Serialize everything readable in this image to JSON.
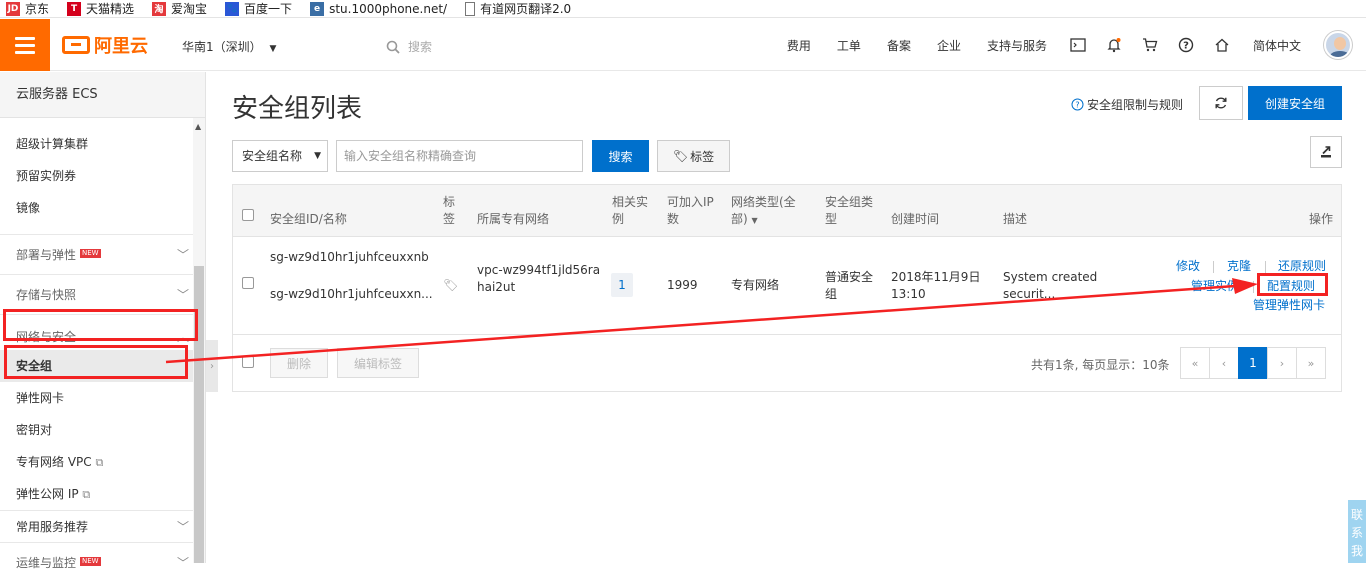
{
  "bookmarks": [
    {
      "label": "京东",
      "icon": "jd-icon",
      "color": "#e4393c",
      "glyph": "JD"
    },
    {
      "label": "天猫精选",
      "icon": "tmall-icon",
      "color": "#d4001c",
      "glyph": "T"
    },
    {
      "label": "爱淘宝",
      "icon": "taobao-icon",
      "color": "#e4393c",
      "glyph": "淘"
    },
    {
      "label": "百度一下",
      "icon": "baidu-icon",
      "color": "#2a57d6",
      "glyph": "🐾"
    },
    {
      "label": "stu.1000phone.net/",
      "icon": "globe-icon",
      "color": "#3a6ea5",
      "glyph": "e"
    },
    {
      "label": "有道网页翻译2.0",
      "icon": "page-icon",
      "color": "#ffffff",
      "glyph": ""
    }
  ],
  "topbar": {
    "brand": "阿里云",
    "region": "华南1（深圳）",
    "search_placeholder": "搜索",
    "links": [
      "费用",
      "工单",
      "备案",
      "企业",
      "支持与服务"
    ],
    "language": "简体中文"
  },
  "sidebar": {
    "title": "云服务器 ECS",
    "items_top": [
      "超级计算集群",
      "预留实例券",
      "镜像"
    ],
    "groups": [
      {
        "label": "部署与弹性",
        "badge": "NEW"
      },
      {
        "label": "存储与快照",
        "badge": ""
      },
      {
        "label": "网络与安全",
        "badge": ""
      }
    ],
    "net_items": [
      "安全组",
      "弹性网卡",
      "密钥对",
      "专有网络 VPC",
      "弹性公网 IP"
    ],
    "bottom_groups": [
      {
        "label": "常用服务推荐",
        "badge": ""
      },
      {
        "label": "运维与监控",
        "badge": "NEW"
      }
    ]
  },
  "main": {
    "title": "安全组列表",
    "limits_link": "安全组限制与规则",
    "create_button": "创建安全组",
    "filter_select": "安全组名称",
    "filter_placeholder": "输入安全组名称精确查询",
    "search_button": "搜索",
    "tag_button": "标签"
  },
  "table": {
    "headers": {
      "id_name": "安全组ID/名称",
      "tag": "标签",
      "vpc": "所属专有网络",
      "instances": "相关实例",
      "ip": "可加入IP数",
      "net_type": "网络类型(全部)",
      "sg_type": "安全组类型",
      "created": "创建时间",
      "desc": "描述",
      "actions": "操作"
    },
    "row": {
      "id": "sg-wz9d10hr1juhfceuxxnb",
      "name": "sg-wz9d10hr1juhfceuxxn...",
      "vpc": "vpc-wz994tf1jld56rahai2ut",
      "instances": "1",
      "ip": "1999",
      "net_type": "专有网络",
      "sg_type": "普通安全组",
      "created": "2018年11月9日 13:10",
      "desc": "System created securit...",
      "actions": {
        "modify": "修改",
        "clone": "克隆",
        "restore": "还原规则",
        "manage_instances": "管理实例",
        "configure_rules": "配置规则",
        "manage_eni": "管理弹性网卡"
      }
    },
    "footer": {
      "delete": "删除",
      "edit_tags": "编辑标签",
      "total": "共有1条, 每页显示：10条",
      "pages": [
        "«",
        "‹",
        "1",
        "›",
        "»"
      ],
      "current_page": "1"
    }
  },
  "contact": "联系我",
  "colors": {
    "accent": "#ff6a00",
    "primary": "#0070cc",
    "annotation": "#f32222"
  }
}
